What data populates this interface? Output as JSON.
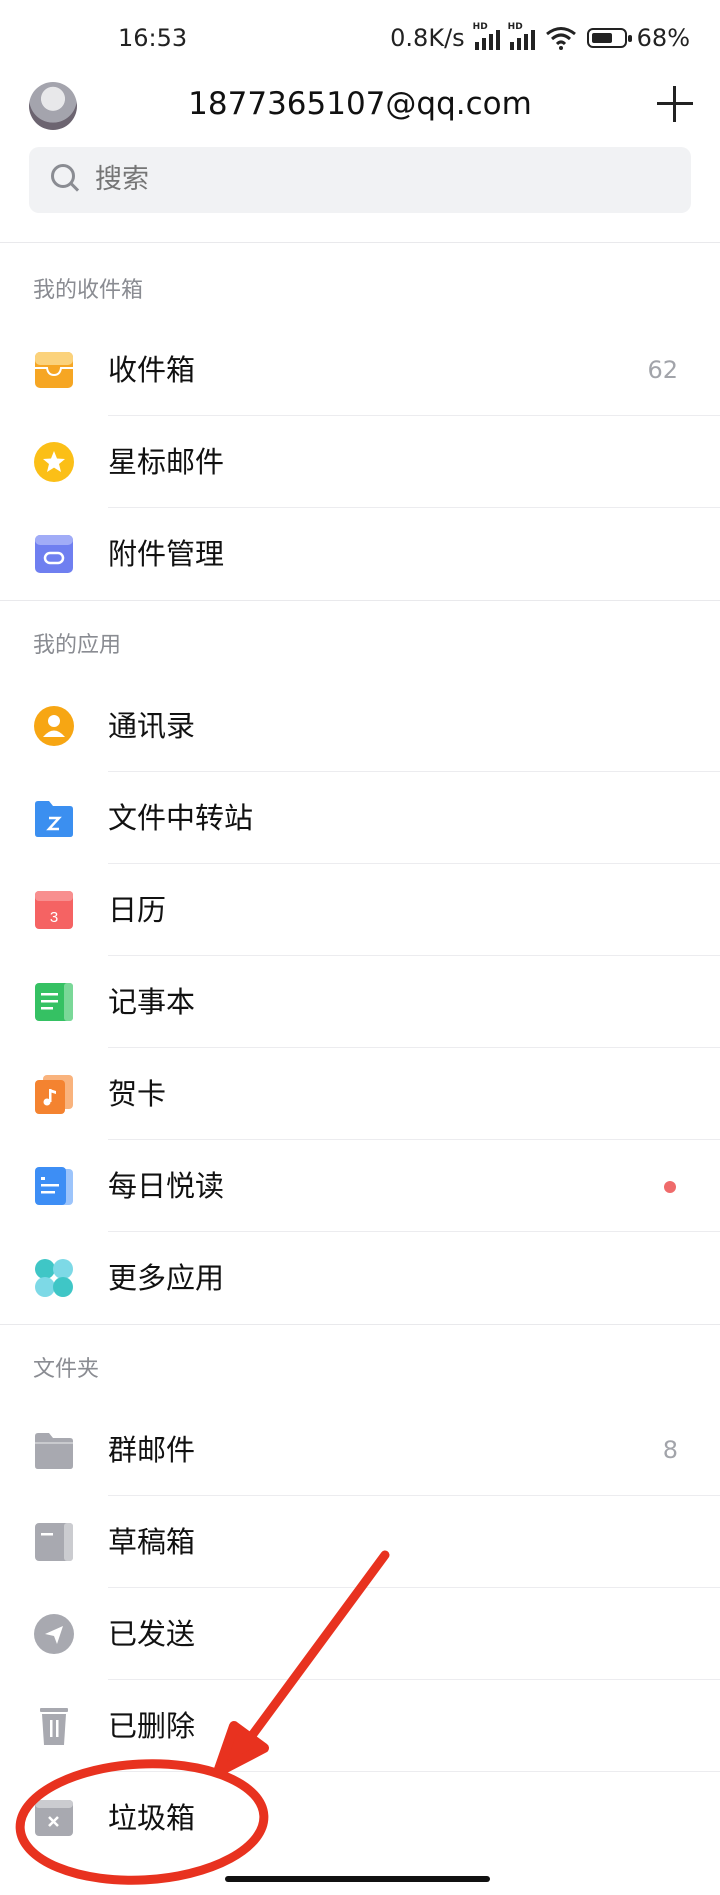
{
  "status_bar": {
    "time": "16:53",
    "speed": "0.8K/s",
    "hd": "HD",
    "battery": "68%"
  },
  "header": {
    "account": "1877365107@qq.com"
  },
  "search": {
    "placeholder": "搜索"
  },
  "sections": [
    {
      "title": "我的收件箱",
      "items": [
        {
          "label": "收件箱",
          "count": "62",
          "icon": "inbox-icon"
        },
        {
          "label": "星标邮件",
          "icon": "star-icon"
        },
        {
          "label": "附件管理",
          "icon": "attachment-icon"
        }
      ]
    },
    {
      "title": "我的应用",
      "items": [
        {
          "label": "通讯录",
          "icon": "contacts-icon"
        },
        {
          "label": "文件中转站",
          "icon": "file-transfer-icon"
        },
        {
          "label": "日历",
          "icon": "calendar-icon",
          "icon_text": "3"
        },
        {
          "label": "记事本",
          "icon": "notepad-icon"
        },
        {
          "label": "贺卡",
          "icon": "greeting-card-icon"
        },
        {
          "label": "每日悦读",
          "icon": "daily-reading-icon"
        },
        {
          "label": "更多应用",
          "icon": "more-apps-icon"
        }
      ]
    },
    {
      "title": "文件夹",
      "items": [
        {
          "label": "群邮件",
          "count": "8",
          "icon": "group-mail-folder-icon"
        },
        {
          "label": "草稿箱",
          "icon": "drafts-icon"
        },
        {
          "label": "已发送",
          "icon": "sent-icon"
        },
        {
          "label": "已删除",
          "icon": "trash-icon"
        },
        {
          "label": "垃圾箱",
          "icon": "spam-icon"
        }
      ]
    }
  ],
  "colors": {
    "accent_annotation": "#e8321f",
    "inbox": "#f6a623",
    "star": "#fbbf17",
    "attachment": "#6f7ff0",
    "contacts": "#f7a613",
    "file_transfer": "#3b8ff0",
    "calendar": "#f56363",
    "notepad": "#35c163",
    "greeting": "#f48330",
    "reading": "#3d8ef5",
    "folder_gray": "#a8a9b0"
  }
}
